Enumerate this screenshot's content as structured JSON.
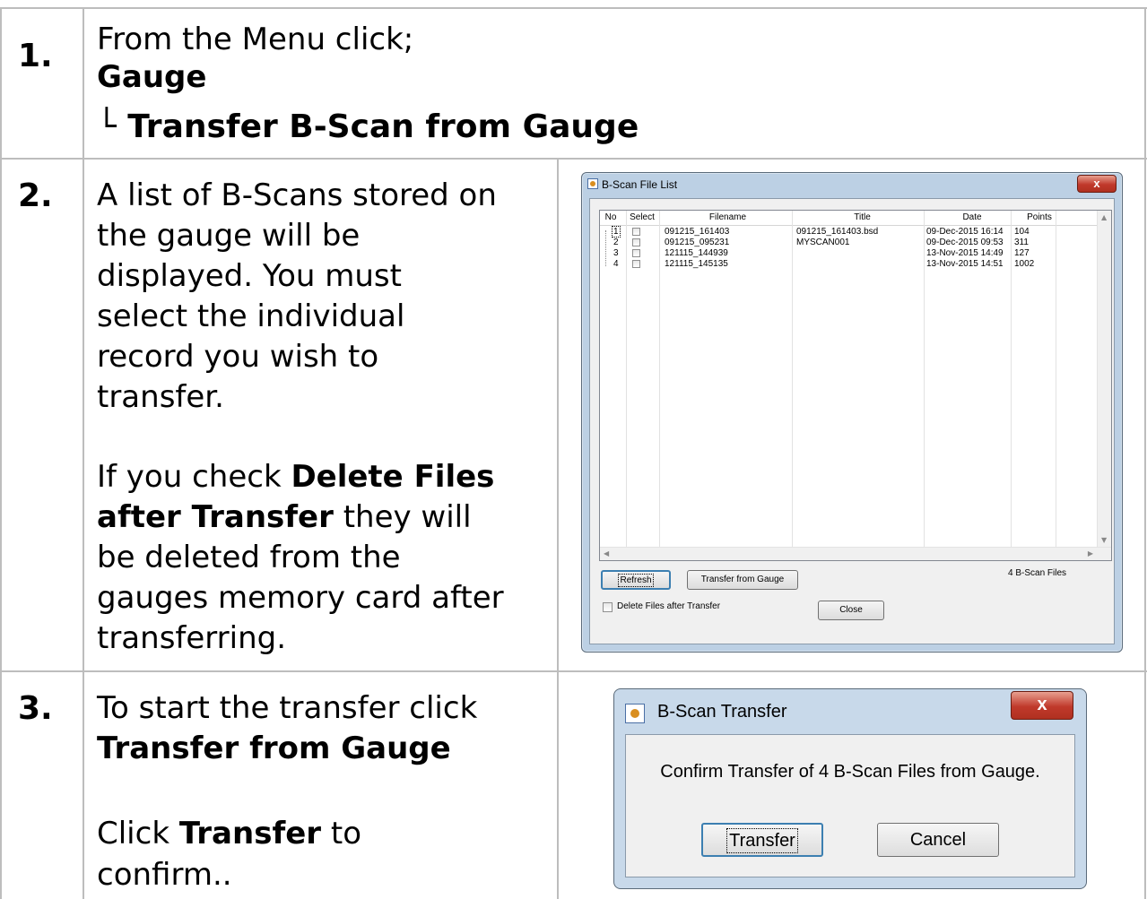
{
  "steps": [
    {
      "number": "1.",
      "line1": "From the Menu click;",
      "line2": "Gauge",
      "line3": "└ Transfer B-Scan from Gauge"
    },
    {
      "number": "2.",
      "p1": [
        "A list of B-Scans stored on",
        "the gauge will be",
        "displayed. You must",
        "select the individual",
        "record you wish to",
        "transfer."
      ],
      "p2_bold1": "Delete Files",
      "p2_pre": "If you check ",
      "p2_bold2": "after Transfer",
      "p2_post": " they will",
      "p2_rest": [
        "be deleted from the",
        "gauges memory card after",
        "transferring."
      ]
    },
    {
      "number": "3.",
      "line1": "To start the transfer click",
      "line2": "Transfer from Gauge",
      "line3_pre": "Click ",
      "line3_bold": "Transfer",
      "line3_post": " to",
      "line4": "confirm.."
    }
  ],
  "file_list_window": {
    "title": "B-Scan File List",
    "close": "x",
    "columns": [
      "No",
      "Select",
      "Filename",
      "Title",
      "Date",
      "Points"
    ],
    "rows": [
      {
        "no": "1",
        "filename": "091215_161403",
        "title": "091215_161403.bsd",
        "date": "09-Dec-2015 16:14",
        "points": "104"
      },
      {
        "no": "2",
        "filename": "091215_095231",
        "title": "MYSCAN001",
        "date": "09-Dec-2015 09:53",
        "points": "311"
      },
      {
        "no": "3",
        "filename": "121115_144939",
        "title": "",
        "date": "13-Nov-2015 14:49",
        "points": "127"
      },
      {
        "no": "4",
        "filename": "121115_145135",
        "title": "",
        "date": "13-Nov-2015 14:51",
        "points": "1002"
      }
    ],
    "refresh_label": "Refresh",
    "transfer_label": "Transfer from Gauge",
    "count_text": "4 B-Scan Files",
    "delete_label": "Delete Files after Transfer",
    "close_label": "Close"
  },
  "transfer_dialog": {
    "title": "B-Scan Transfer",
    "close": "x",
    "message": "Confirm Transfer of 4 B-Scan Files from Gauge.",
    "transfer_label": "Transfer",
    "cancel_label": "Cancel"
  }
}
